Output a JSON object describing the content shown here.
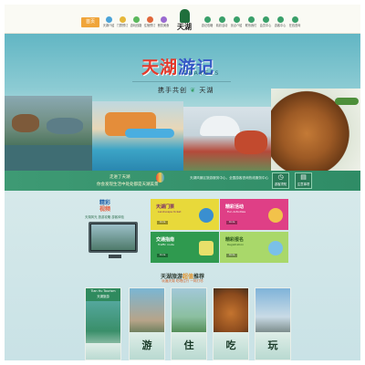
{
  "header": {
    "home_label": "首页",
    "logo_text": "天湖",
    "nav_left": [
      "天湖介绍",
      "门票预订",
      "游玩线路",
      "住宿预订",
      "餐饮美食"
    ],
    "nav_right": [
      "游记攻略",
      "精彩活动",
      "景点介绍",
      "联系我们",
      "会员中心",
      "游客中心",
      "在线咨询"
    ]
  },
  "hero": {
    "title_red": "天湖",
    "title_blue": "游记",
    "title_en": "TRAVELS",
    "subtitle": "携手共创",
    "subtitle_tail": "天湖"
  },
  "greenbar": {
    "line1": "走进了天湖",
    "line2": "你会发现生活中处处都是天湖美景",
    "line3": "天湖风景区旅游服务中心，全国游客咨询热线服务中心",
    "btn1_label": "游客须知",
    "btn2_label": "注意事项"
  },
  "feature": {
    "title_line1": "精彩",
    "title_line2": "视频",
    "desc": "天湖风光 旅游攻略 游客体验"
  },
  "tiles": [
    {
      "title": "天湖门票",
      "sub": "Landscape ticket",
      "more": "more"
    },
    {
      "title": "精彩活动",
      "sub": "Fun Activities",
      "more": "more"
    },
    {
      "title": "交通指南",
      "sub": "Traffic route",
      "more": "more"
    },
    {
      "title": "精彩报名",
      "sub": "Registration",
      "more": "more"
    }
  ],
  "recommend": {
    "title_a": "天湖旅游",
    "title_highlight": "超值",
    "title_b": "推荐",
    "subtitle": "玩遍天湖 吃喝住行 一网打尽",
    "cards": [
      {
        "header": "Tian Hu Tourism",
        "header2": "天湖旅游",
        "label": ""
      },
      {
        "label": "游"
      },
      {
        "label": "住"
      },
      {
        "label": "吃"
      },
      {
        "label": "玩"
      }
    ]
  },
  "colors": {
    "header_bg": "#fafaf4",
    "home_button": "#f0a53a",
    "green_bar": "#3e9a74",
    "tile_yellow": "#e8d93a",
    "tile_pink": "#df3f86",
    "tile_green": "#2f9a4f",
    "tile_lightgreen": "#a9d86a"
  }
}
